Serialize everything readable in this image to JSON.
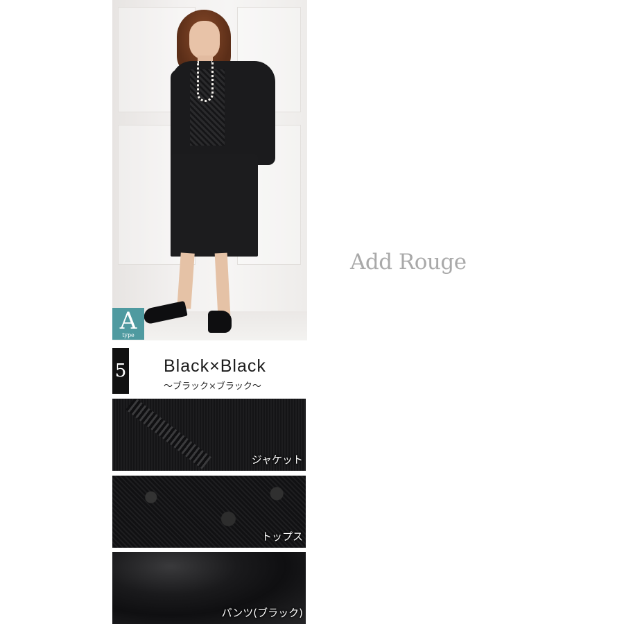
{
  "brand": {
    "name": "Add Rouge"
  },
  "type_badge": {
    "letter": "A",
    "sub": "type",
    "color": "#4f9aa0"
  },
  "color_variant": {
    "number": "5",
    "name": "Black×Black",
    "sub_name": "〜ブラック×ブラック〜"
  },
  "fabric_swatches": [
    {
      "label": "ジャケット"
    },
    {
      "label": "トップス"
    },
    {
      "label": "パンツ(ブラック)"
    }
  ]
}
